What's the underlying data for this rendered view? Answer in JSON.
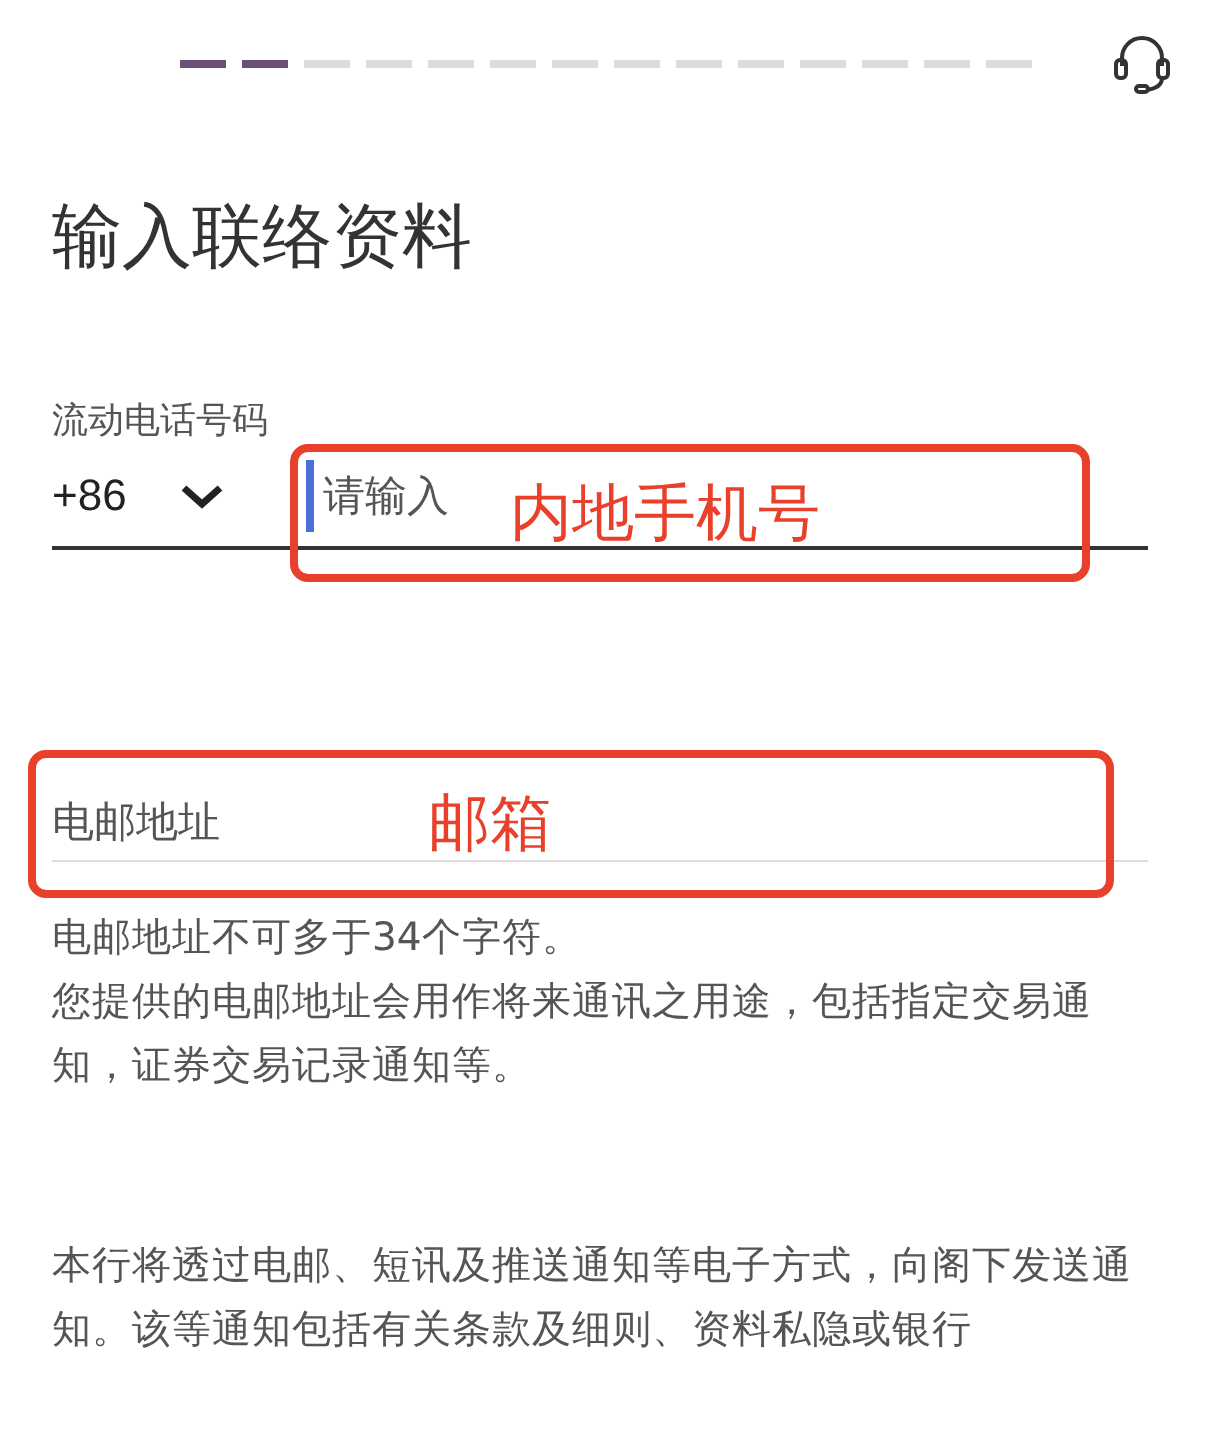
{
  "progress_steps": [
    {
      "done": true
    },
    {
      "done": true
    },
    {
      "done": false
    },
    {
      "done": false
    },
    {
      "done": false
    },
    {
      "done": false
    },
    {
      "done": false
    },
    {
      "done": false
    },
    {
      "done": false
    },
    {
      "done": false
    },
    {
      "done": false
    },
    {
      "done": false
    },
    {
      "done": false
    },
    {
      "done": false
    }
  ],
  "title": "输入联络资料",
  "phone": {
    "label": "流动电话号码",
    "country_code": "+86",
    "placeholder": "请输入",
    "focused": true
  },
  "email": {
    "placeholder": "电邮地址"
  },
  "email_notes": [
    "电邮地址不可多于34个字符。",
    "您提供的电邮地址会用作将来通讯之用途，包括指定交易通知，证券交易记录通知等。"
  ],
  "notice": "本行将透过电邮、短讯及推送通知等电子方式，向阁下发送通知。该等通知包括有关条款及细则、资料私隐或银行",
  "annotations": [
    {
      "kind": "phone",
      "text": "内地手机号"
    },
    {
      "kind": "email",
      "text": "邮箱"
    }
  ]
}
